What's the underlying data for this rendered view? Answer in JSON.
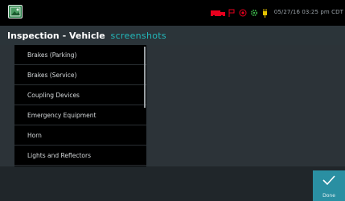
{
  "statusbar": {
    "app_icon": "photo-app-icon",
    "icons": [
      "truck-icon",
      "flag-icon",
      "gps-icon",
      "gear-icon",
      "plug-icon"
    ],
    "datetime": "05/27/16 03:25 pm CDT",
    "colors": {
      "truck": "#e8001e",
      "gps": "#e8001e",
      "plug": "#e6c400",
      "gear": "#3bb54a"
    }
  },
  "header": {
    "title": "Inspection - Vehicle",
    "subtitle": "screenshots"
  },
  "list": {
    "items": [
      {
        "label": "Brakes (Parking)"
      },
      {
        "label": "Brakes (Service)"
      },
      {
        "label": "Coupling Devices"
      },
      {
        "label": "Emergency Equipment"
      },
      {
        "label": "Horn"
      },
      {
        "label": "Lights and Reflectors"
      }
    ]
  },
  "footer": {
    "done_label": "Done",
    "accent": "#2a8fa2"
  }
}
